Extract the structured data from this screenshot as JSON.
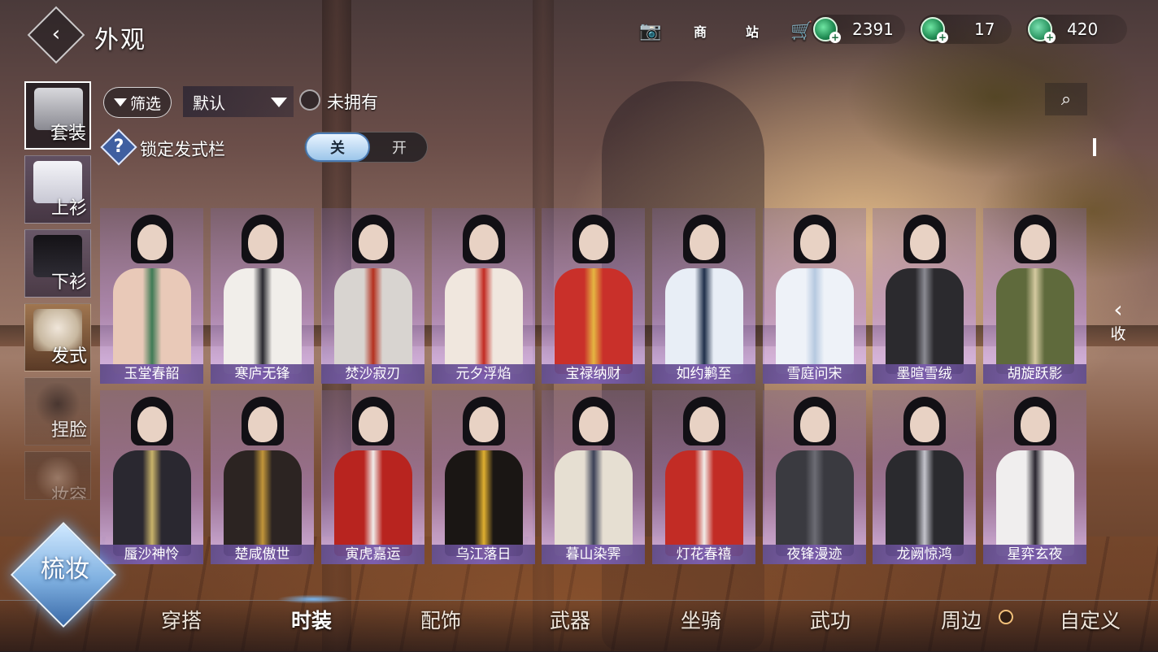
{
  "header": {
    "title": "外观"
  },
  "top_icons": [
    {
      "name": "camera-icon",
      "glyph": "📷"
    },
    {
      "name": "shop-icon",
      "glyph": "商"
    },
    {
      "name": "station-icon",
      "glyph": "站"
    },
    {
      "name": "cart-icon",
      "glyph": "🛒"
    }
  ],
  "currencies": [
    {
      "value": "2391"
    },
    {
      "value": "17"
    },
    {
      "value": "420"
    }
  ],
  "categories": [
    {
      "label": "套装",
      "active": true
    },
    {
      "label": "上衫",
      "active": false
    },
    {
      "label": "下衫",
      "active": false
    },
    {
      "label": "发式",
      "active": false
    },
    {
      "label": "捏脸",
      "active": false
    },
    {
      "label": "妆容",
      "active": false
    }
  ],
  "filter": {
    "filter_label": "筛选",
    "sort_value": "默认",
    "unowned_label": "未拥有"
  },
  "lock": {
    "help_glyph": "?",
    "label": "锁定发式栏",
    "toggle_on": "关",
    "toggle_off": "开"
  },
  "outfits_row1": [
    {
      "name": "玉堂春韶",
      "body": "#e9c9b8",
      "accent": "#3f7a55"
    },
    {
      "name": "寒庐无锋",
      "body": "#f1eeea",
      "accent": "#2a2a30"
    },
    {
      "name": "焚沙寂刃",
      "body": "#d8d4d0",
      "accent": "#b4301e"
    },
    {
      "name": "元夕浮焰",
      "body": "#f0e7de",
      "accent": "#c22a22"
    },
    {
      "name": "宝禄纳财",
      "body": "#c9302a",
      "accent": "#e5b642"
    },
    {
      "name": "如约鹣至",
      "body": "#e8eef6",
      "accent": "#1f2f4a"
    },
    {
      "name": "雪庭问宋",
      "body": "#eef2f8",
      "accent": "#b6c9e0"
    },
    {
      "name": "墨暄雪绒",
      "body": "#2b2a2e",
      "accent": "#8a8a92"
    },
    {
      "name": "胡旋跃影",
      "body": "#5f6a3c",
      "accent": "#d4c9a0"
    }
  ],
  "outfits_row2": [
    {
      "name": "蜃沙神怜",
      "body": "#2a2830",
      "accent": "#c9b36a"
    },
    {
      "name": "楚咸傲世",
      "body": "#2c2422",
      "accent": "#c2963a"
    },
    {
      "name": "寅虎嘉运",
      "body": "#b8241f",
      "accent": "#f0ecea"
    },
    {
      "name": "乌江落日",
      "body": "#1a1614",
      "accent": "#e0b030"
    },
    {
      "name": "暮山染霁",
      "body": "#e6dfd2",
      "accent": "#3a4056"
    },
    {
      "name": "灯花春禧",
      "body": "#c22c25",
      "accent": "#f1ede9"
    },
    {
      "name": "夜锋漫迹",
      "body": "#3a3a40",
      "accent": "#6c6c74"
    },
    {
      "name": "龙阙惊鸿",
      "body": "#2a2a2e",
      "accent": "#c4c4cc"
    },
    {
      "name": "星弈玄夜",
      "body": "#f0eeee",
      "accent": "#2a2630"
    }
  ],
  "collapse": {
    "label": "收",
    "arrow": "‹"
  },
  "makeup_button": {
    "label": "梳妆"
  },
  "bottom_tabs": [
    {
      "label": "穿搭"
    },
    {
      "label": "时装"
    },
    {
      "label": "配饰"
    },
    {
      "label": "武器"
    },
    {
      "label": "坐骑"
    },
    {
      "label": "武功"
    },
    {
      "label": "周边"
    },
    {
      "label": "自定义"
    }
  ],
  "colors": {
    "accent_blue": "#9cc6ea",
    "card_purple": "#b996e6",
    "coin_green": "#1f8a52"
  }
}
